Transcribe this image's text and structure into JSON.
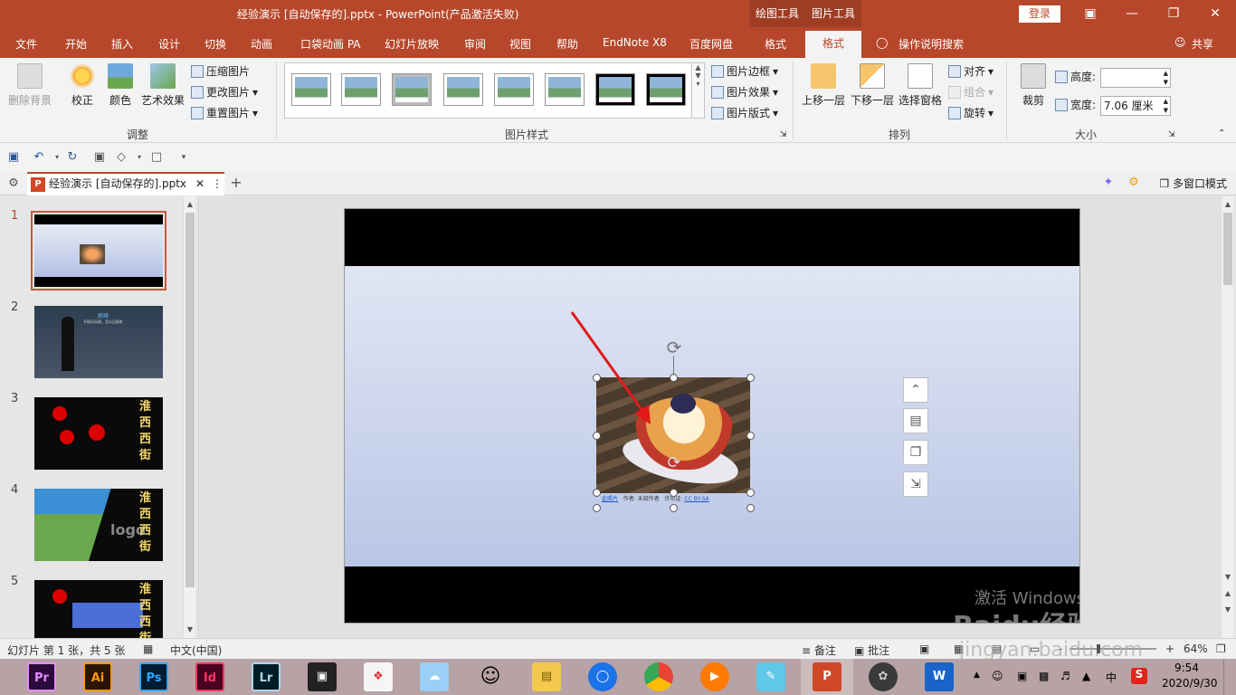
{
  "window": {
    "title": "经验演示 [自动保存的].pptx  -  PowerPoint(产品激活失败)",
    "context_tab_drawing": "绘图工具",
    "context_tab_picture": "图片工具",
    "login_label": "登录",
    "min_icon": "minimize-icon",
    "max_icon": "maximize-icon",
    "close_icon": "close-icon"
  },
  "menu": {
    "items": [
      "文件",
      "开始",
      "插入",
      "设计",
      "切换",
      "动画",
      "口袋动画 PA",
      "幻灯片放映",
      "审阅",
      "视图",
      "帮助",
      "EndNote X8",
      "百度网盘",
      "格式"
    ],
    "active": "格式",
    "tellme": "操作说明搜索",
    "share": "共享"
  },
  "ribbon": {
    "remove_bg": "删除背景",
    "correct": "校正",
    "color": "颜色",
    "artistic": "艺术效果",
    "compress": "压缩图片",
    "change": "更改图片",
    "reset": "重置图片",
    "group_adjust": "调整",
    "group_styles": "图片样式",
    "border": "图片边框",
    "effects": "图片效果",
    "layout": "图片版式",
    "bring_forward": "上移一层",
    "send_backward": "下移一层",
    "selection_pane": "选择窗格",
    "align": "对齐",
    "group": "组合",
    "rotate": "旋转",
    "group_arrange": "排列",
    "crop": "裁剪",
    "height_label": "高度:",
    "height_value": "",
    "width_label": "宽度:",
    "width_value": "7.06 厘米",
    "group_size": "大小"
  },
  "doc": {
    "tab_title": "经验演示 [自动保存的].pptx",
    "multiwindow": "多窗口模式"
  },
  "slides": {
    "numbers": [
      "1",
      "2",
      "3",
      "4",
      "5"
    ],
    "slide2_title": "巅峰",
    "slide2_sub": "不经历风雨，怎么见彩虹",
    "slide3_text": "淮西西街",
    "slide4_text": "淮西西街",
    "slide4_logo": "logo",
    "slide5_text": "淮西西街"
  },
  "canvas": {
    "caption_link1": "此照片",
    "caption_author": "作者: 未知作者",
    "caption_license_label": "许可证:",
    "caption_license": "CC BY-SA",
    "watermark_activate": "激活 Windows",
    "watermark_site": "jingyan.baidu.com",
    "watermark_brand": "Baidu经验"
  },
  "status": {
    "slide_info": "幻灯片 第 1 张，共 5 张",
    "language": "中文(中国)",
    "notes": "备注",
    "comments": "批注",
    "zoom": "64%",
    "minus": "-",
    "plus": "+"
  },
  "taskbar": {
    "apps": [
      "Pr",
      "Ai",
      "Ps",
      "Id",
      "Lr"
    ],
    "time": "9:54",
    "date": "2020/9/30",
    "ime": "中"
  },
  "colors": {
    "accent": "#b7472a",
    "ribbon_bg": "#f3f3f3",
    "slide_bar": "#000000",
    "arrow": "#e01a1a"
  }
}
